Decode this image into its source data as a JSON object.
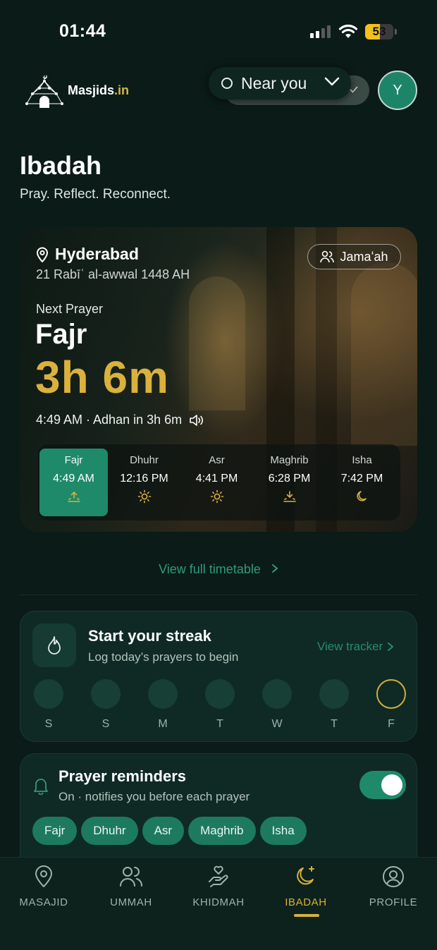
{
  "status": {
    "time": "01:44",
    "battery": "53",
    "battery_level": 0.53
  },
  "header": {
    "logo_name": "Masjids",
    "logo_tld": ".in",
    "location_filter": "Near you",
    "avatar_initial": "Y"
  },
  "page": {
    "title": "Ibadah",
    "subtitle": "Pray. Reflect. Reconnect."
  },
  "hero": {
    "city": "Hyderabad",
    "hijri_date": "21 Rabīʿ al-awwal 1448 AH",
    "jamaah_label": "Jamaʻah",
    "next_label": "Next Prayer",
    "next_prayer": "Fajr",
    "countdown": "3h 6m",
    "adhan_line": "4:49 AM · Adhan in 3h 6m",
    "prayers": [
      {
        "name": "Fajr",
        "time": "4:49 AM",
        "icon": "sunrise-icon",
        "active": true
      },
      {
        "name": "Dhuhr",
        "time": "12:16 PM",
        "icon": "sun-icon"
      },
      {
        "name": "Asr",
        "time": "4:41 PM",
        "icon": "sun-icon"
      },
      {
        "name": "Maghrib",
        "time": "6:28 PM",
        "icon": "sunset-icon"
      },
      {
        "name": "Isha",
        "time": "7:42 PM",
        "icon": "moon-icon"
      }
    ]
  },
  "timetable_link": "View full timetable",
  "streak": {
    "title": "Start your streak",
    "subtitle": "Log today’s prayers to begin",
    "tracker_link": "View tracker",
    "days": [
      "S",
      "S",
      "M",
      "T",
      "W",
      "T",
      "F"
    ]
  },
  "reminders": {
    "title": "Prayer reminders",
    "subtitle": "On · notifies you before each prayer",
    "enabled": true,
    "chips": [
      "Fajr",
      "Dhuhr",
      "Asr",
      "Maghrib",
      "Isha"
    ]
  },
  "nav": [
    {
      "label": "MASAJID",
      "icon": "location-pin-icon"
    },
    {
      "label": "UMMAH",
      "icon": "people-icon"
    },
    {
      "label": "KHIDMAH",
      "icon": "helping-hand-icon"
    },
    {
      "label": "IBADAH",
      "icon": "crescent-moon-icon",
      "active": true
    },
    {
      "label": "PROFILE",
      "icon": "profile-icon"
    }
  ],
  "colors": {
    "accent_green": "#1e8a6a",
    "gold": "#d9b13c",
    "background": "#0b1b17"
  }
}
